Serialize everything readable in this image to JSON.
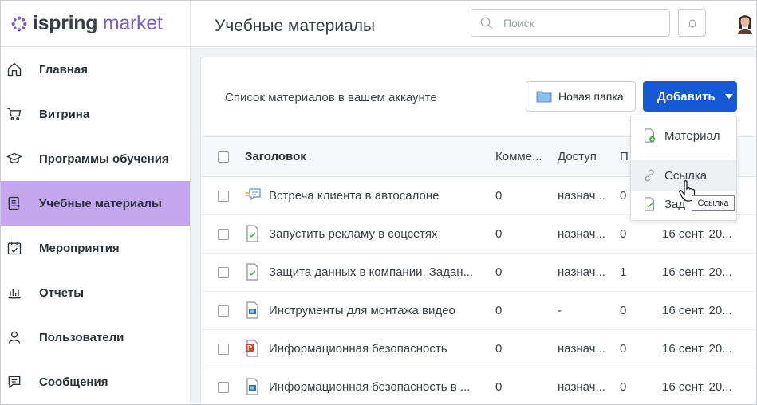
{
  "brand": {
    "part1": "ispring",
    "part2": " market",
    "accent": "#7a5cc9"
  },
  "header": {
    "title": "Учебные материалы",
    "search_placeholder": "Поиск"
  },
  "sidebar": {
    "active_color": "#c3a6ec",
    "items": [
      {
        "label": "Главная",
        "icon": "home-icon"
      },
      {
        "label": "Витрина",
        "icon": "cart-icon"
      },
      {
        "label": "Программы обучения",
        "icon": "graduation-cap-icon"
      },
      {
        "label": "Учебные материалы",
        "icon": "document-icon",
        "active": true
      },
      {
        "label": "Мероприятия",
        "icon": "calendar-check-icon"
      },
      {
        "label": "Отчеты",
        "icon": "bar-chart-icon"
      },
      {
        "label": "Пользователи",
        "icon": "user-icon"
      },
      {
        "label": "Сообщения",
        "icon": "message-icon"
      }
    ]
  },
  "content": {
    "subtitle": "Список материалов в вашем аккаунте",
    "new_folder_label": "Новая папка",
    "add_label": "Добавить",
    "add_color": "#1759d4"
  },
  "table": {
    "columns": [
      "Заголовок",
      "Комме...",
      "Доступ",
      "П"
    ],
    "sort_indicator": "↓",
    "rows": [
      {
        "icon": "dialogue-icon",
        "title": "Встреча клиента в автосалоне",
        "comments": "0",
        "access": "назнач...",
        "p": "0",
        "date": ""
      },
      {
        "icon": "quiz-icon",
        "title": "Запустить рекламу в соцсетях",
        "comments": "0",
        "access": "назнач...",
        "p": "0",
        "date": "16 сент. 20..."
      },
      {
        "icon": "quiz-icon",
        "title": "Защита данных в компании. Задан...",
        "comments": "0",
        "access": "назнач...",
        "p": "1",
        "date": "16 сент. 20..."
      },
      {
        "icon": "video-icon",
        "title": "Инструменты для монтажа видео",
        "comments": "0",
        "access": "-",
        "p": "0",
        "date": "16 сент. 20..."
      },
      {
        "icon": "powerpoint-icon",
        "title": "Информационная безопасность",
        "comments": "0",
        "access": "назнач...",
        "p": "0",
        "date": "16 сент. 20..."
      },
      {
        "icon": "video-icon",
        "title": "Информационная безопасность в ...",
        "comments": "0",
        "access": "назнач...",
        "p": "0",
        "date": "16 сент. 20..."
      }
    ]
  },
  "dropdown": {
    "items": [
      {
        "label": "Материал",
        "icon": "add-file-icon"
      },
      {
        "label": "Ссылка",
        "icon": "link-icon",
        "hover": true
      },
      {
        "label": "Зад",
        "icon": "task-icon"
      }
    ],
    "tooltip": "Ссылка"
  }
}
